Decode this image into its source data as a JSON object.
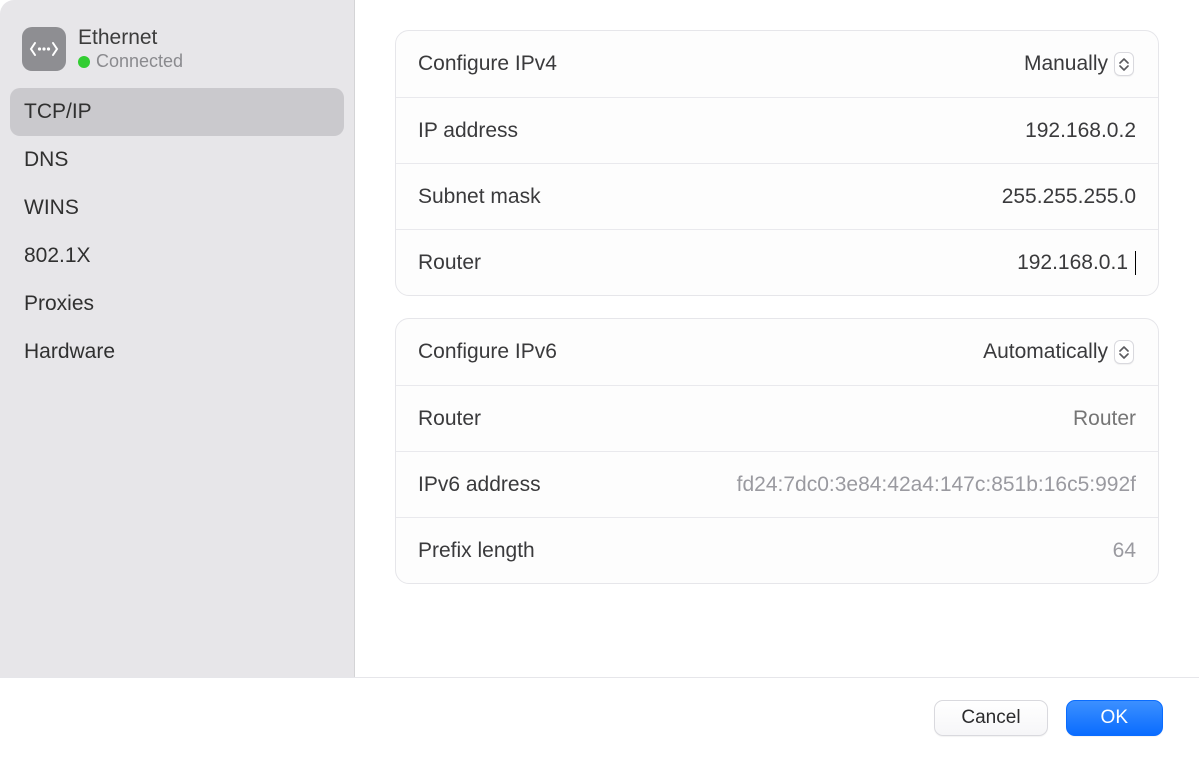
{
  "connection": {
    "name": "Ethernet",
    "status": "Connected"
  },
  "sidebar": {
    "items": [
      {
        "label": "TCP/IP",
        "selected": true
      },
      {
        "label": "DNS"
      },
      {
        "label": "WINS"
      },
      {
        "label": "802.1X"
      },
      {
        "label": "Proxies"
      },
      {
        "label": "Hardware"
      }
    ]
  },
  "ipv4": {
    "configure_label": "Configure IPv4",
    "configure_value": "Manually",
    "ip_label": "IP address",
    "ip_value": "192.168.0.2",
    "subnet_label": "Subnet mask",
    "subnet_value": "255.255.255.0",
    "router_label": "Router",
    "router_value": "192.168.0.1"
  },
  "ipv6": {
    "configure_label": "Configure IPv6",
    "configure_value": "Automatically",
    "router_label": "Router",
    "router_placeholder": "Router",
    "address_label": "IPv6 address",
    "address_value": "fd24:7dc0:3e84:42a4:147c:851b:16c5:992f",
    "prefix_label": "Prefix length",
    "prefix_value": "64"
  },
  "footer": {
    "cancel": "Cancel",
    "ok": "OK"
  }
}
